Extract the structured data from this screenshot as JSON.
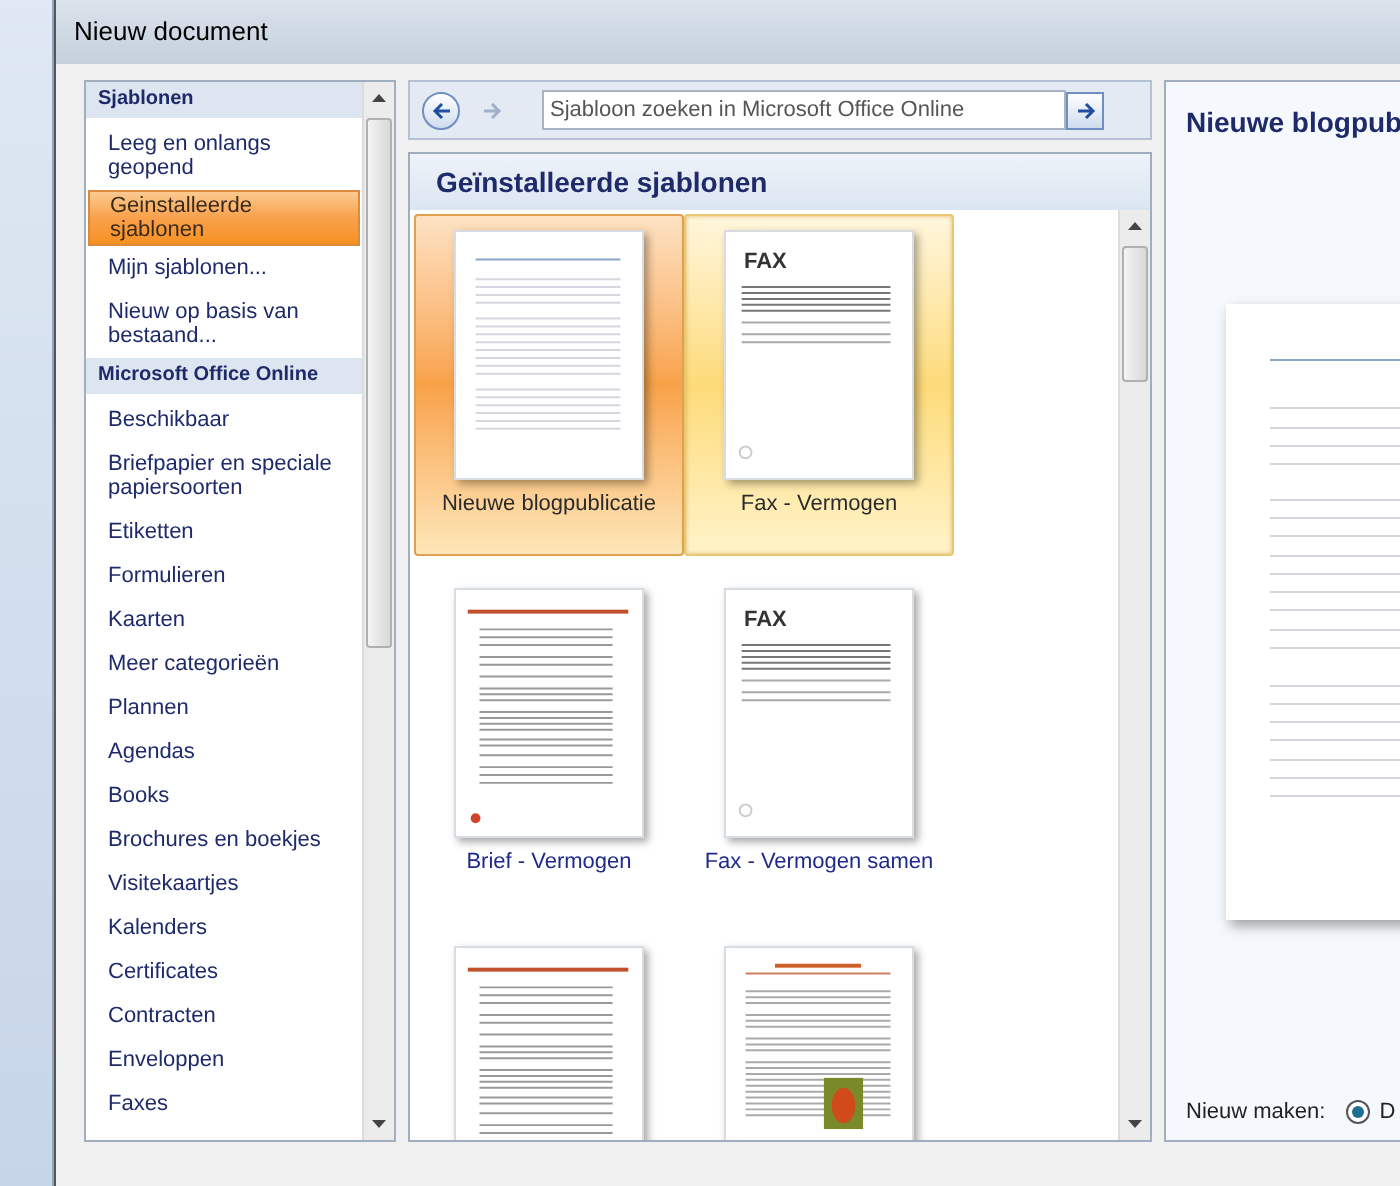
{
  "window": {
    "title": "Nieuw document"
  },
  "sidebar": {
    "items": [
      {
        "label": "Sjablonen",
        "kind": "header"
      },
      {
        "label": "Leeg en onlangs geopend",
        "kind": "item",
        "selected": false
      },
      {
        "label": "Geinstalleerde sjablonen",
        "kind": "item",
        "selected": true
      },
      {
        "label": "Mijn sjablonen...",
        "kind": "item",
        "selected": false
      },
      {
        "label": "Nieuw op basis van bestaand...",
        "kind": "item",
        "selected": false
      },
      {
        "label": "Microsoft Office Online",
        "kind": "header"
      },
      {
        "label": "Beschikbaar",
        "kind": "item",
        "selected": false
      },
      {
        "label": "Briefpapier en speciale papiersoorten",
        "kind": "item",
        "selected": false
      },
      {
        "label": "Etiketten",
        "kind": "item",
        "selected": false
      },
      {
        "label": "Formulieren",
        "kind": "item",
        "selected": false
      },
      {
        "label": "Kaarten",
        "kind": "item",
        "selected": false
      },
      {
        "label": "Meer categorieën",
        "kind": "item",
        "selected": false
      },
      {
        "label": "Plannen",
        "kind": "item",
        "selected": false
      },
      {
        "label": "Agendas",
        "kind": "item",
        "selected": false
      },
      {
        "label": "Books",
        "kind": "item",
        "selected": false
      },
      {
        "label": "Brochures en boekjes",
        "kind": "item",
        "selected": false
      },
      {
        "label": "Visitekaartjes",
        "kind": "item",
        "selected": false
      },
      {
        "label": "Kalenders",
        "kind": "item",
        "selected": false
      },
      {
        "label": "Certificates",
        "kind": "item",
        "selected": false
      },
      {
        "label": "Contracten",
        "kind": "item",
        "selected": false
      },
      {
        "label": "Enveloppen",
        "kind": "item",
        "selected": false
      },
      {
        "label": "Faxes",
        "kind": "item",
        "selected": false
      }
    ]
  },
  "search": {
    "placeholder": "Sjabloon zoeken in Microsoft Office Online"
  },
  "gallery": {
    "title": "Geïnstalleerde sjablonen",
    "templates": [
      {
        "label": "Nieuwe blogpublicatie",
        "kind": "blog",
        "selected": true,
        "hovered": false
      },
      {
        "label": "Fax - Vermogen",
        "kind": "fax",
        "selected": false,
        "hovered": true,
        "thumb_title": "FAX"
      },
      {
        "label": "Brief - Vermogen",
        "kind": "letter",
        "selected": false,
        "hovered": false
      },
      {
        "label": "Fax - Vermogen samen",
        "kind": "fax",
        "selected": false,
        "hovered": false,
        "thumb_title": "FAX"
      },
      {
        "kind": "letter",
        "selected": false,
        "hovered": false
      },
      {
        "kind": "newsletter",
        "selected": false,
        "hovered": false
      }
    ]
  },
  "preview": {
    "title": "Nieuwe blogpub",
    "create_label": "Nieuw maken:",
    "options": [
      {
        "label": "D",
        "selected": true
      }
    ]
  }
}
